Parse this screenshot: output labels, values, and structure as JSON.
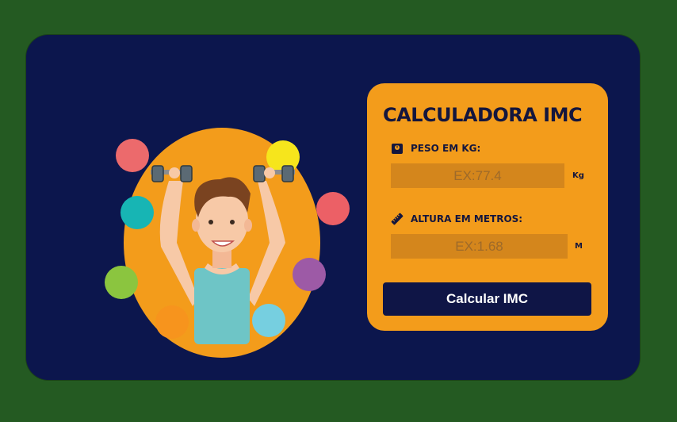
{
  "calculator": {
    "title": "CALCULADORA IMC",
    "weight": {
      "label": "PESO EM KG:",
      "placeholder": "EX:77.4",
      "unit": "Kg"
    },
    "height": {
      "label": "ALTURA EM METROS:",
      "placeholder": "EX:1.68",
      "unit": "M"
    },
    "button_label": "Calcular IMC"
  },
  "colors": {
    "page_background": "#245a22",
    "card_background": "#0c164d",
    "panel_background": "#f39c1b",
    "input_background": "#d4861c",
    "button_background": "#0f1546",
    "text_dark": "#14163d"
  },
  "icons": {
    "weight_icon": "scale-icon",
    "height_icon": "ruler-icon"
  }
}
